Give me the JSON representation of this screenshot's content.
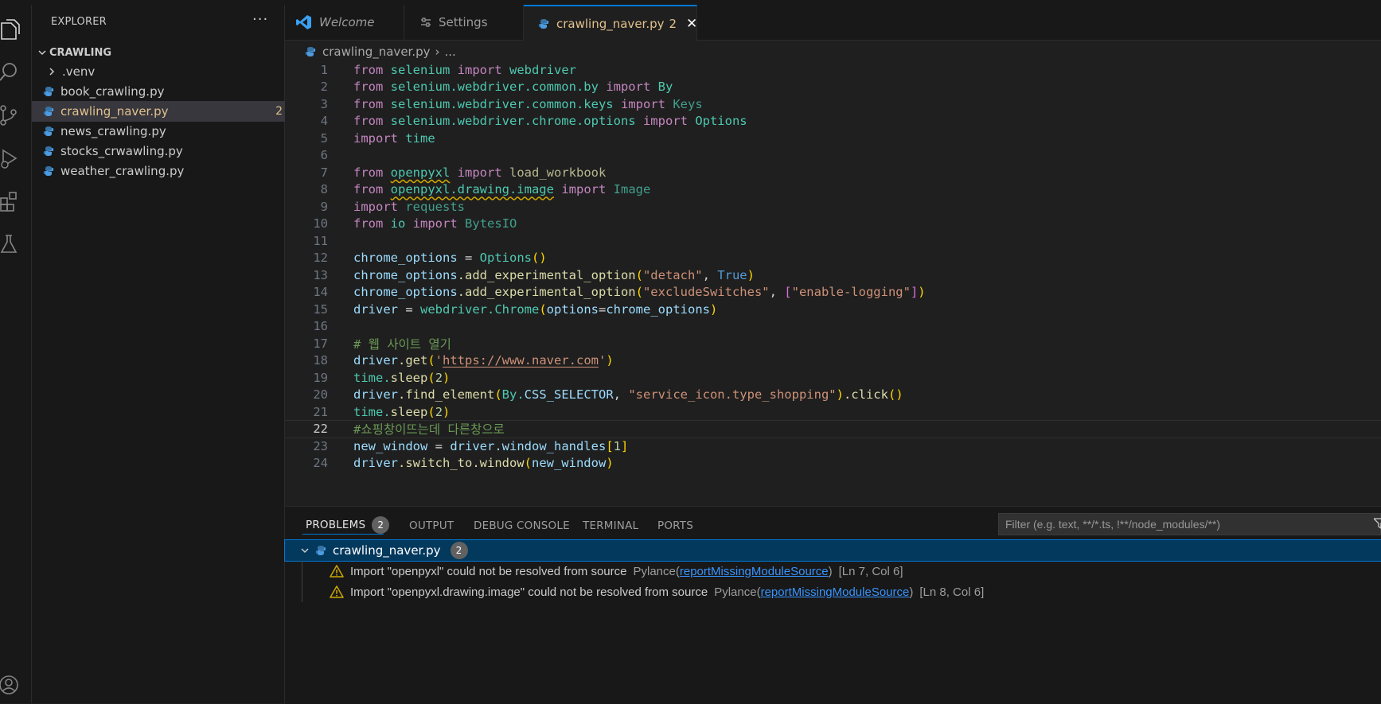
{
  "sidebar": {
    "title": "EXPLORER",
    "more": "···",
    "section": "CRAWLING",
    "items": [
      {
        "label": ".venv",
        "type": "folder"
      },
      {
        "label": "book_crawling.py",
        "type": "file"
      },
      {
        "label": "crawling_naver.py",
        "type": "file",
        "badge": "2"
      },
      {
        "label": "news_crawling.py",
        "type": "file"
      },
      {
        "label": "stocks_crwawling.py",
        "type": "file"
      },
      {
        "label": "weather_crawling.py",
        "type": "file"
      }
    ]
  },
  "tabs": [
    {
      "label": "Welcome"
    },
    {
      "label": "Settings"
    },
    {
      "label": "crawling_naver.py",
      "badge": "2",
      "close": "✕"
    }
  ],
  "breadcrumb": {
    "file": "crawling_naver.py",
    "sep": "›",
    "rest": "..."
  },
  "editor": {
    "line_numbers": [
      "1",
      "2",
      "3",
      "4",
      "5",
      "6",
      "7",
      "8",
      "9",
      "10",
      "11",
      "12",
      "13",
      "14",
      "15",
      "16",
      "17",
      "18",
      "19",
      "20",
      "21",
      "22",
      "23",
      "24"
    ],
    "current_line": 22,
    "tokens": {
      "from": "from",
      "import": "import",
      "selenium": "selenium",
      "webdriver": "webdriver",
      "common_by": "selenium.webdriver.common.by",
      "By": "By",
      "common_keys": "selenium.webdriver.common.keys",
      "Keys": "Keys",
      "chrome_options_mod": "selenium.webdriver.chrome.options",
      "Options": "Options",
      "time": "time",
      "openpyxl": "openpyxl",
      "load_workbook": "load_workbook",
      "openpyxl_drawing": "openpyxl.drawing.image",
      "Image": "Image",
      "requests": "requests",
      "io": "io",
      "BytesIO": "BytesIO",
      "chrome_options": "chrome_options",
      "eq": " = ",
      "paren_open": "(",
      "paren_close": ")",
      "add_exp": ".add_experimental_option",
      "detach": "\"detach\"",
      "comma": ", ",
      "True": "True",
      "excludeSwitches": "\"excludeSwitches\"",
      "bracket_open": "[",
      "bracket_close": "]",
      "enable_logging": "\"enable-logging\"",
      "driver": "driver",
      "wd_dot": "webdriver.",
      "Chrome": "Chrome",
      "options_kw": "options",
      "eq_tight": "=",
      "comment1": "# 웹 사이트 열기",
      "get": ".get",
      "q": "'",
      "url": "https://www.naver.com",
      "time_dot": "time.",
      "sleep": "sleep",
      "two": "2",
      "find_element": ".find_element",
      "By_dot": "By.",
      "CSS_SELECTOR": "CSS_SELECTOR",
      "selector": "\"service_icon.type_shopping\"",
      "click": ".click",
      "comment2": "#쇼핑창이뜨는데 다른창으로",
      "new_window": "new_window",
      "window_handles": ".window_handles",
      "one": "1",
      "switch_to_window": ".switch_to.window"
    }
  },
  "panel": {
    "tabs": {
      "problems": "PROBLEMS",
      "problems_count": "2",
      "output": "OUTPUT",
      "debug": "DEBUG CONSOLE",
      "terminal": "TERMINAL",
      "ports": "PORTS"
    },
    "filter_placeholder": "Filter (e.g. text, **/*.ts, !**/node_modules/**)",
    "file": {
      "name": "crawling_naver.py",
      "count": "2"
    },
    "problems": [
      {
        "message": "Import \"openpyxl\" could not be resolved from source",
        "source": "Pylance",
        "code": "reportMissingModuleSource",
        "location": "[Ln 7, Col 6]"
      },
      {
        "message": "Import \"openpyxl.drawing.image\" could not be resolved from source",
        "source": "Pylance",
        "code": "reportMissingModuleSource",
        "location": "[Ln 8, Col 6]"
      }
    ]
  },
  "colors": {
    "accent": "#0078d4",
    "modified": "#e2c08d",
    "warning": "#cca700",
    "selection": "#04395e"
  }
}
